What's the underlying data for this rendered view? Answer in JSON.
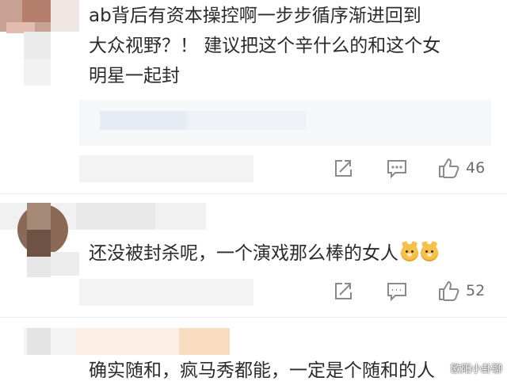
{
  "comments": [
    {
      "lines": [
        "ab背后有资本操控啊一步步循序渐进回到",
        "大众视野？！ 建议把这个辛什么的和这个女",
        "明星一起封"
      ],
      "reply_preview": "",
      "likes": "46"
    },
    {
      "lines": [
        "还没被封杀呢，一个演戏那么棒的女人"
      ],
      "emoji_count": 2,
      "likes": "52"
    },
    {
      "lines": [
        "确实随和，疯马秀都能，一定是个随和的人"
      ]
    }
  ],
  "icons": [
    "share-icon",
    "comment-icon",
    "like-icon"
  ],
  "watermark": "欧阳小卦聊",
  "colors": {
    "icon": "#8a8a8a",
    "text": "#2b2b2b",
    "count": "#6b6b6b",
    "divider": "#ececec"
  }
}
